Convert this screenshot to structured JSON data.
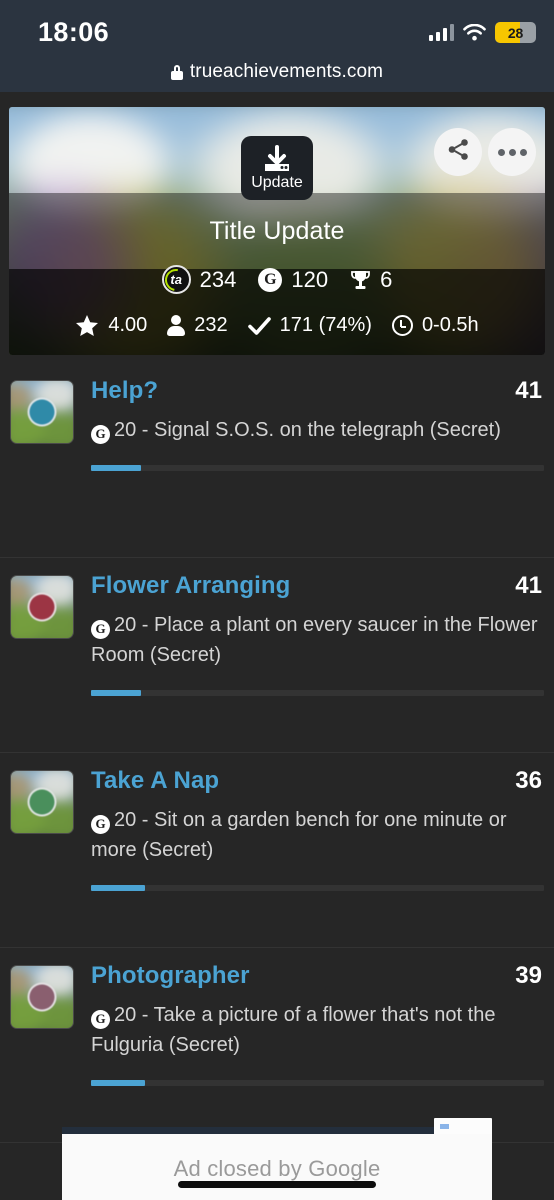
{
  "statusbar": {
    "time": "18:06",
    "battery_level": "28",
    "signal_icon": "cellular-signal-icon",
    "wifi_icon": "wifi-icon",
    "battery_icon": "battery-icon"
  },
  "browser": {
    "lock_icon": "lock-icon",
    "url": "trueachievements.com"
  },
  "hero": {
    "update_badge_label": "Update",
    "download_icon": "download-icon",
    "share_icon": "share-icon",
    "more_icon": "more-options-icon",
    "title": "Title Update",
    "stats_primary": [
      {
        "icon": "trueachievement-score-icon",
        "value": "234"
      },
      {
        "icon": "gamerscore-icon",
        "value": "120"
      },
      {
        "icon": "trophy-icon",
        "value": "6"
      }
    ],
    "stats_secondary": [
      {
        "icon": "star-icon",
        "value": "4.00"
      },
      {
        "icon": "person-icon",
        "value": "232"
      },
      {
        "icon": "check-icon",
        "value": "171 (74%)"
      },
      {
        "icon": "clock-icon",
        "value": "0-0.5h"
      }
    ]
  },
  "achievements": [
    {
      "name": "Help?",
      "ratio": "41",
      "gamerscore": "20",
      "description": "20 - Signal S.O.S. on the telegraph (Secret)",
      "description_text": " - Signal S.O.S. on the telegraph (Secret)",
      "progress_percent": 11,
      "badge_color": "#2f8aa8",
      "lines": 1
    },
    {
      "name": "Flower Arranging",
      "ratio": "41",
      "gamerscore": "20",
      "description": "20 - Place a plant on every saucer in the Flower Room (Secret)",
      "description_text": " - Place a plant on every saucer in the Flower Room (Secret)",
      "progress_percent": 11,
      "badge_color": "#9c3544",
      "lines": 2
    },
    {
      "name": "Take A Nap",
      "ratio": "36",
      "gamerscore": "20",
      "description": "20 - Sit on a garden bench for one minute or more (Secret)",
      "description_text": " - Sit on a garden bench for one minute or more (Secret)",
      "progress_percent": 12,
      "badge_color": "#4a8f5c",
      "lines": 2
    },
    {
      "name": "Photographer",
      "ratio": "39",
      "gamerscore": "20",
      "description": "20 - Take a picture of a flower that's not the Fulguria (Secret)",
      "description_text": " - Take a picture of a flower that's not the Fulguria (Secret)",
      "progress_percent": 12,
      "badge_color": "#8a5f6f",
      "lines": 2
    }
  ],
  "ad": {
    "closed_label": "Ad closed by Google"
  },
  "colors": {
    "accent_blue": "#4ba3d3",
    "page_bg": "#262626",
    "statusbar_bg": "#2b3440",
    "battery_yellow": "#f7c600"
  }
}
